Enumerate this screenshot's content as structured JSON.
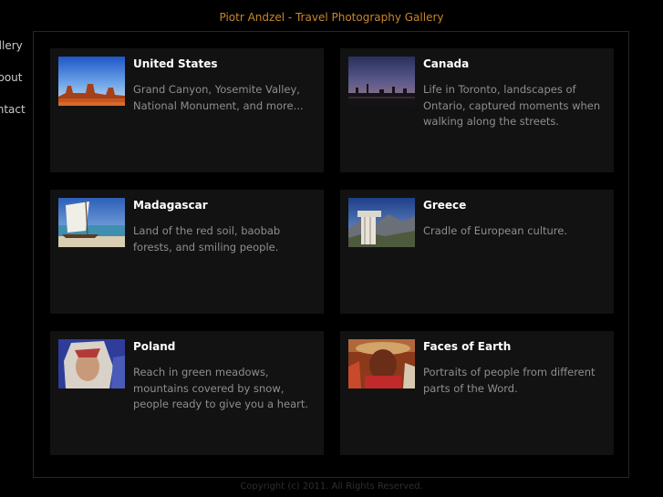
{
  "header": {
    "title": "Piotr Andzel - Travel Photography Gallery"
  },
  "nav": {
    "items": [
      {
        "label": "Gallery"
      },
      {
        "label": "About"
      },
      {
        "label": "Contact"
      }
    ]
  },
  "galleries": [
    {
      "title": "United States",
      "description": "Grand Canyon, Yosemite Valley, National Monument, and more..."
    },
    {
      "title": "Canada",
      "description": "Life in Toronto, landscapes of Ontario, captured moments when walking along the streets."
    },
    {
      "title": "Madagascar",
      "description": "Land of the red soil, baobab forests, and smiling people."
    },
    {
      "title": "Greece",
      "description": "Cradle of European culture."
    },
    {
      "title": "Poland",
      "description": "Reach in green meadows, mountains covered by snow, people ready to give you a heart."
    },
    {
      "title": "Faces of Earth",
      "description": "Portraits of people from different parts of the Word."
    }
  ],
  "footer": {
    "copyright": "Copyright (c) 2011. All Rights Reserved."
  },
  "colors": {
    "background": "#000000",
    "title_accent": "#c8862a",
    "card_background": "#121212",
    "card_title": "#ffffff",
    "card_text": "#8e8e8e"
  }
}
